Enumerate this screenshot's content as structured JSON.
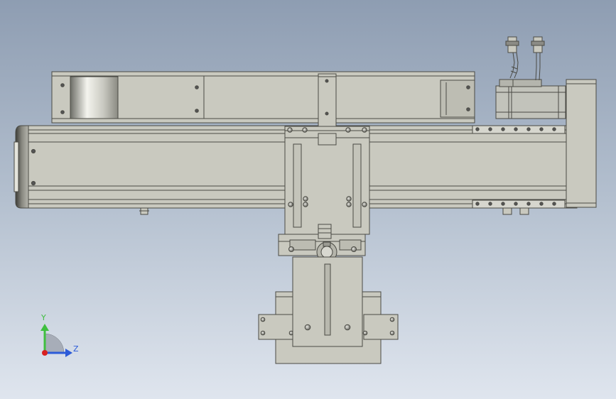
{
  "triad": {
    "y_label": "Y",
    "z_label": "Z",
    "y_color": "#3fbf3f",
    "z_color": "#2c5bd8",
    "origin_color": "#d82020"
  },
  "colors": {
    "part_fill": "#c9c9bf",
    "part_stroke": "#4a4a44",
    "motor_fill": "#c2c3bb"
  }
}
